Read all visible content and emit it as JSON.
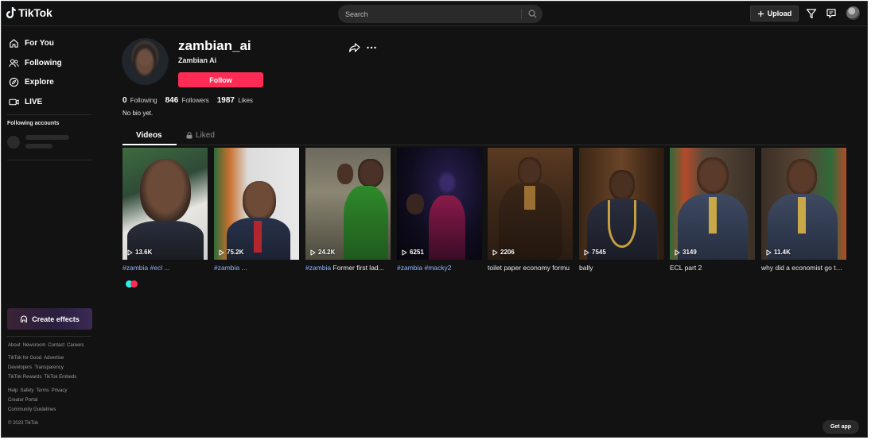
{
  "header": {
    "logo_text": "TikTok",
    "search_placeholder": "Search",
    "upload_label": "Upload"
  },
  "sidebar": {
    "nav": [
      {
        "label": "For You",
        "icon": "home-icon"
      },
      {
        "label": "Following",
        "icon": "following-icon"
      },
      {
        "label": "Explore",
        "icon": "compass-icon"
      },
      {
        "label": "LIVE",
        "icon": "live-icon"
      }
    ],
    "following_heading": "Following accounts",
    "create_effects_label": "Create effects",
    "footer_rows": [
      [
        "About",
        "Newsroom",
        "Contact",
        "Careers"
      ],
      [
        "TikTok for Good",
        "Advertise"
      ],
      [
        "Developers",
        "Transparency"
      ],
      [
        "TikTok Rewards",
        "TikTok Embeds"
      ],
      [
        "Help",
        "Safety",
        "Terms",
        "Privacy"
      ],
      [
        "Creator Portal"
      ],
      [
        "Community Guidelines"
      ]
    ],
    "copyright": "© 2023 TikTok"
  },
  "profile": {
    "username": "zambian_ai",
    "display_name": "Zambian Ai",
    "follow_label": "Follow",
    "following_count": "0",
    "following_label": "Following",
    "followers_count": "846",
    "followers_label": "Followers",
    "likes_count": "1987",
    "likes_label": "Likes",
    "bio": "No bio yet."
  },
  "tabs": {
    "videos": "Videos",
    "liked": "Liked"
  },
  "videos": [
    {
      "views": "13.6K",
      "caption_tag": "#zambia #ecl ...",
      "caption_text": ""
    },
    {
      "views": "75.2K",
      "caption_tag": "#zambia ...",
      "caption_text": ""
    },
    {
      "views": "24.2K",
      "caption_tag": "#zambia",
      "caption_text": " Former first lad..."
    },
    {
      "views": "6251",
      "caption_tag": "#zambia #macky2",
      "caption_text": ""
    },
    {
      "views": "2206",
      "caption_tag": "",
      "caption_text": "toilet paper economy formu"
    },
    {
      "views": "7545",
      "caption_tag": "",
      "caption_text": "bally"
    },
    {
      "views": "3149",
      "caption_tag": "",
      "caption_text": "ECL part 2"
    },
    {
      "views": "11.4K",
      "caption_tag": "",
      "caption_text": "why did a economist go to ..."
    }
  ],
  "get_app_label": "Get app",
  "colors": {
    "accent": "#fe2c55",
    "hashtag": "#8fb5ff",
    "background": "#121212",
    "loader_cyan": "#25f4ee"
  }
}
